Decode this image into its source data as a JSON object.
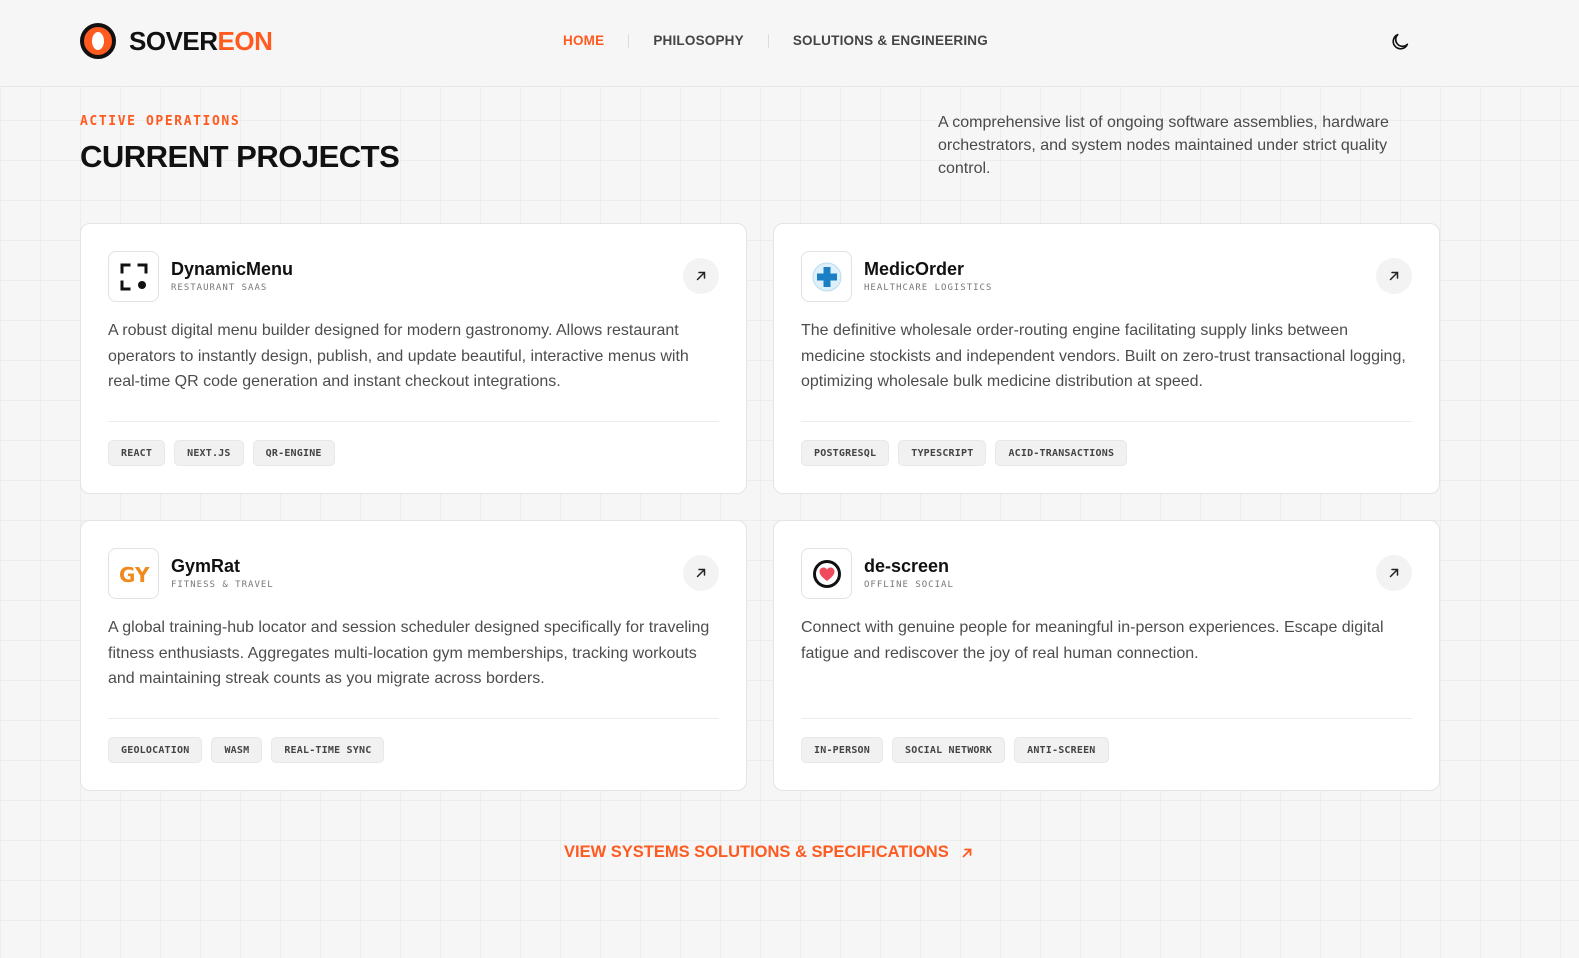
{
  "brand": {
    "name_part1": "SOVER",
    "name_part2": "EON",
    "accent_color": "#ff5a1f"
  },
  "nav": {
    "items": [
      {
        "label": "HOME",
        "active": true
      },
      {
        "label": "PHILOSOPHY",
        "active": false
      },
      {
        "label": "SOLUTIONS & ENGINEERING",
        "active": false
      }
    ],
    "theme_toggle_icon": "moon-icon"
  },
  "section": {
    "eyebrow": "ACTIVE OPERATIONS",
    "title": "CURRENT PROJECTS",
    "intro": "A comprehensive list of ongoing software assemblies, hardware orchestrators, and system nodes maintained under strict quality control."
  },
  "projects": [
    {
      "name": "DynamicMenu",
      "category": "RESTAURANT SAAS",
      "icon": "qr-scan-icon",
      "description": "A robust digital menu builder designed for modern gastronomy. Allows restaurant operators to instantly design, publish, and update beautiful, interactive menus with real-time QR code generation and instant checkout integrations.",
      "tags": [
        "REACT",
        "NEXT.JS",
        "QR-ENGINE"
      ]
    },
    {
      "name": "MedicOrder",
      "category": "HEALTHCARE LOGISTICS",
      "icon": "medical-cross-icon",
      "description": "The definitive wholesale order-routing engine facilitating supply links between medicine stockists and independent vendors. Built on zero-trust transactional logging, optimizing wholesale bulk medicine distribution at speed.",
      "tags": [
        "POSTGRESQL",
        "TYPESCRIPT",
        "ACID-TRANSACTIONS"
      ]
    },
    {
      "name": "GymRat",
      "category": "FITNESS & TRAVEL",
      "icon": "gym-logo-icon",
      "icon_text": "GYM",
      "description": "A global training-hub locator and session scheduler designed specifically for traveling fitness enthusiasts. Aggregates multi-location gym memberships, tracking workouts and maintaining streak counts as you migrate across borders.",
      "tags": [
        "GEOLOCATION",
        "WASM",
        "REAL-TIME SYNC"
      ]
    },
    {
      "name": "de-screen",
      "category": "OFFLINE SOCIAL",
      "icon": "heart-icon",
      "description": "Connect with genuine people for meaningful in-person experiences. Escape digital fatigue and rediscover the joy of real human connection.",
      "tags": [
        "IN-PERSON",
        "SOCIAL NETWORK",
        "ANTI-SCREEN"
      ]
    }
  ],
  "cta": {
    "label": "VIEW SYSTEMS SOLUTIONS & SPECIFICATIONS",
    "icon": "arrow-up-right-icon"
  }
}
